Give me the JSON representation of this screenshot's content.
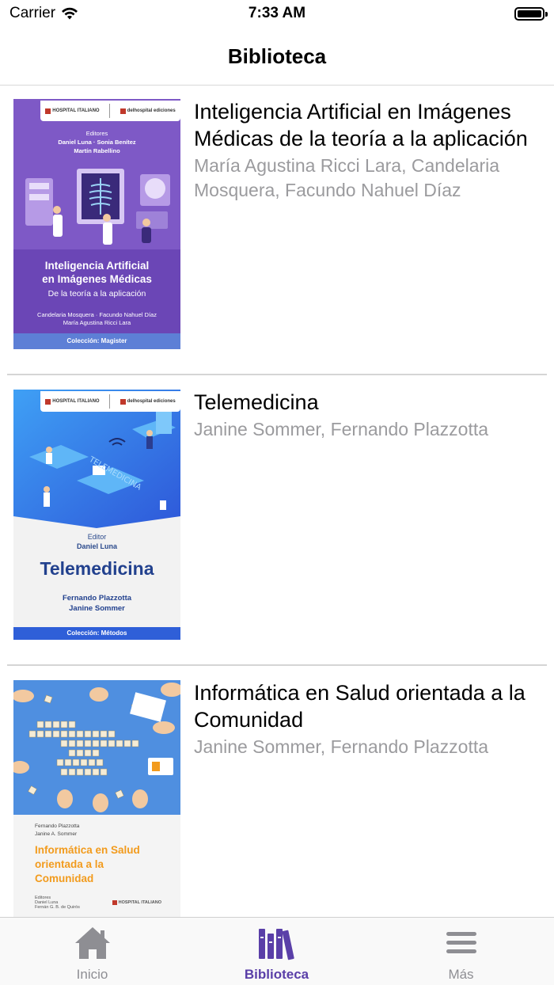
{
  "status_bar": {
    "carrier": "Carrier",
    "time": "7:33 AM"
  },
  "nav": {
    "title": "Biblioteca"
  },
  "books": [
    {
      "title": "Inteligencia Artificial en Imágenes Médicas de la teoría a la aplicación",
      "authors": "María Agustina Ricci Lara, Candelaria Mosquera, Facundo Nahuel Díaz",
      "cover": {
        "logo_left": "HOSPITAL ITALIANO",
        "logo_right": "delhospital ediciones",
        "editors_label": "Editores",
        "editors_line1": "Daniel Luna · Sonia Benítez",
        "editors_line2": "Martín Rabellino",
        "title_line1": "Inteligencia Artificial",
        "title_line2": "en Imágenes Médicas",
        "subtitle": "De la teoría a la aplicación",
        "authors_line1": "Candelaria Mosquera · Facundo Nahuel Díaz",
        "authors_line2": "María Agustina Ricci Lara",
        "collection": "Colección: Magister"
      }
    },
    {
      "title": "Telemedicina",
      "authors": "Janine Sommer, Fernando Plazzotta",
      "cover": {
        "logo_left": "HOSPITAL ITALIANO",
        "logo_right": "delhospital ediciones",
        "editor_label": "Editor",
        "editor_name": "Daniel Luna",
        "title": "Telemedicina",
        "authors_line1": "Fernando Plazzotta",
        "authors_line2": "Janine Sommer",
        "collection": "Colección: Métodos"
      }
    },
    {
      "title": "Informática en Salud orientada a la Comunidad",
      "authors": "Janine Sommer, Fernando Plazzotta",
      "cover": {
        "authors_line1": "Fernando Plazzotta",
        "authors_line2": "Janine A. Sommer",
        "title_line1": "Informática en Salud",
        "title_line2": "orientada a la",
        "title_line3": "Comunidad",
        "editors_label": "Editores",
        "editors_line1": "Daniel Luna",
        "editors_line2": "Fernán G. B. de Quirós",
        "logo": "HOSPITAL ITALIANO"
      }
    }
  ],
  "tabs": [
    {
      "label": "Inicio",
      "icon": "home-icon",
      "active": false
    },
    {
      "label": "Biblioteca",
      "icon": "library-icon",
      "active": true
    },
    {
      "label": "Más",
      "icon": "menu-icon",
      "active": false
    }
  ],
  "colors": {
    "accent": "#5a3fa8",
    "inactive": "#8e8e93",
    "secondary_text": "#9b9b9e"
  }
}
